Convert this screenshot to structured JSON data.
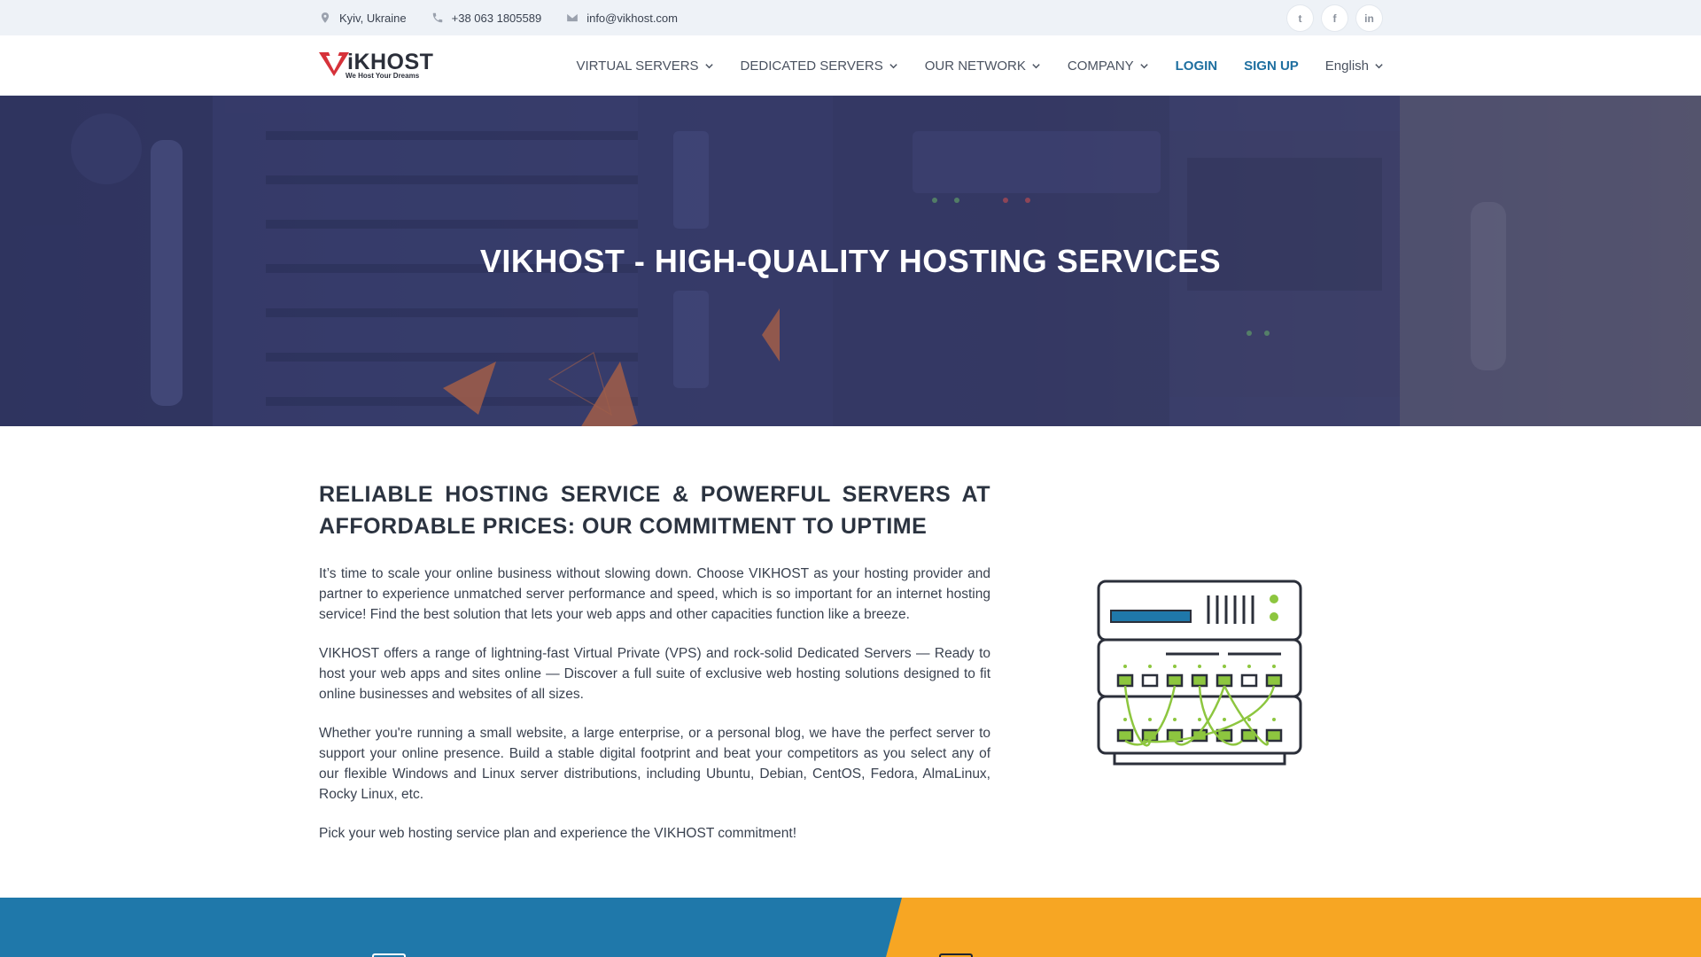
{
  "topbar": {
    "location": "Kyiv, Ukraine",
    "phone": "+38 063 1805589",
    "email": "info@vikhost.com",
    "socials": [
      {
        "icon": "twitter-icon",
        "glyph": "t"
      },
      {
        "icon": "facebook-icon",
        "glyph": "f"
      },
      {
        "icon": "linkedin-icon",
        "glyph": "in"
      }
    ]
  },
  "logo": {
    "word": "iKHOST",
    "tagline": "We Host Your Dreams"
  },
  "nav": {
    "virtual_servers": "VIRTUAL SERVERS",
    "dedicated_servers": "DEDICATED SERVERS",
    "our_network": "OUR NETWORK",
    "company": "COMPANY",
    "login": "LOGIN",
    "sign_up": "SIGN UP",
    "language": "English"
  },
  "hero": {
    "title": "VIKHOST - HIGH-QUALITY HOSTING SERVICES"
  },
  "intro": {
    "heading": "RELIABLE HOSTING SERVICE & POWERFUL SERVERS AT AFFORDABLE PRICES: OUR COMMITMENT TO UPTIME",
    "paragraphs": [
      "It’s time to scale your online business without slowing down. Choose VIKHOST as your hosting provider and partner to experience unmatched server performance and speed, which is so important for an internet hosting service! Find the best solution that lets your web apps and other capacities function like a breeze.",
      "VIKHOST offers a range of lightning-fast Virtual Private (VPS) and rock-solid Dedicated Servers — Ready to host your web apps and sites online — Discover a full suite of exclusive web hosting solutions designed to fit online businesses and websites of all sizes.",
      "Whether you're running a small website, a large enterprise, or a personal blog, we have the perfect server to support your online presence. Build a stable digital footprint and beat your competitors as you select any of our flexible Windows and Linux server distributions, including Ubuntu, Debian, CentOS, Fedora, AlmaLinux, Rocky Linux, etc.",
      "Pick your web hosting service plan and experience the VIKHOST commitment!"
    ]
  },
  "colors": {
    "accent_blue": "#1f78aa",
    "accent_orange": "#f7a623",
    "logo_red": "#d6323a",
    "rack_green": "#8dc63f"
  }
}
